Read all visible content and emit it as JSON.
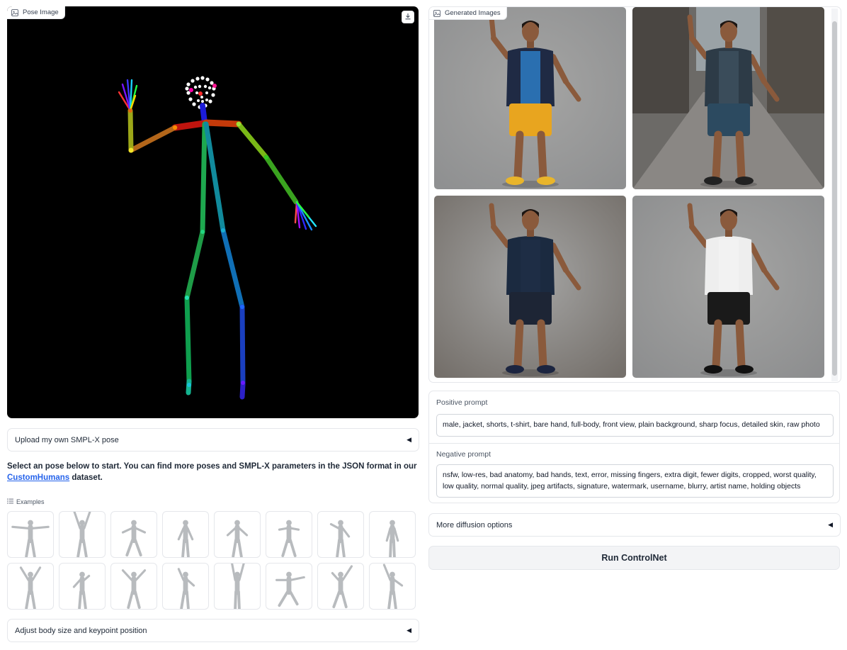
{
  "pose_panel": {
    "label": "Pose Image",
    "label_icon": "image-icon",
    "download_icon": "download-icon"
  },
  "upload_accordion": {
    "label": "Upload my own SMPL-X pose",
    "icon": "triangle-left-icon"
  },
  "intro": {
    "text_before": "Select an pose below to start. You can find more poses and SMPL-X parameters in the JSON format in our ",
    "link_text": "CustomHumans",
    "text_after": " dataset."
  },
  "examples": {
    "label": "Examples",
    "label_icon": "list-icon",
    "thumbs": [
      "t-pose",
      "arms-raised",
      "arms-bent",
      "standing",
      "arms-out",
      "hands-hips",
      "one-arm",
      "standing-straight",
      "hands-up",
      "walking",
      "flex",
      "dancing",
      "reaching-up",
      "kicking",
      "running",
      "waving"
    ]
  },
  "adjust_accordion": {
    "label": "Adjust body size and keypoint position",
    "icon": "triangle-left-icon"
  },
  "generated_panel": {
    "label": "Generated Images",
    "label_icon": "image-icon",
    "images": [
      {
        "name": "man-blue-jacket-yellow-shorts",
        "bg": "#8f9091",
        "shirt": "#2a6fb0",
        "jacket": "#1f2a44",
        "shorts": "#e8a51f",
        "shoes": "#e9b52b"
      },
      {
        "name": "man-street-grey-shirt",
        "bg": "#6c6a67",
        "shirt": "#3a4c5a",
        "jacket": "#2d3b47",
        "shorts": "#2c4a60",
        "shoes": "#222222"
      },
      {
        "name": "man-navy-hoodie",
        "bg": "#75706b",
        "shirt": "#1e2d45",
        "jacket": "#1b2a40",
        "shorts": "#1d2535",
        "shoes": "#1c2540"
      },
      {
        "name": "man-white-jacket-black-shorts",
        "bg": "#8d8e8f",
        "shirt": "#f2f2f2",
        "jacket": "#eeeeee",
        "shorts": "#1a1a1a",
        "shoes": "#111111"
      }
    ]
  },
  "positive_prompt": {
    "label": "Positive prompt",
    "value": "male, jacket, shorts, t-shirt, bare hand, full-body, front view, plain background, sharp focus, detailed skin, raw photo"
  },
  "negative_prompt": {
    "label": "Negative prompt",
    "value": "nsfw, low-res, bad anatomy, bad hands, text, error, missing fingers, extra digit, fewer digits, cropped, worst quality, low quality, normal quality, jpeg artifacts, signature, watermark, username, blurry, artist name, holding objects"
  },
  "diffusion_accordion": {
    "label": "More diffusion options",
    "icon": "triangle-left-icon"
  },
  "run_button": {
    "label": "Run ControlNet"
  }
}
